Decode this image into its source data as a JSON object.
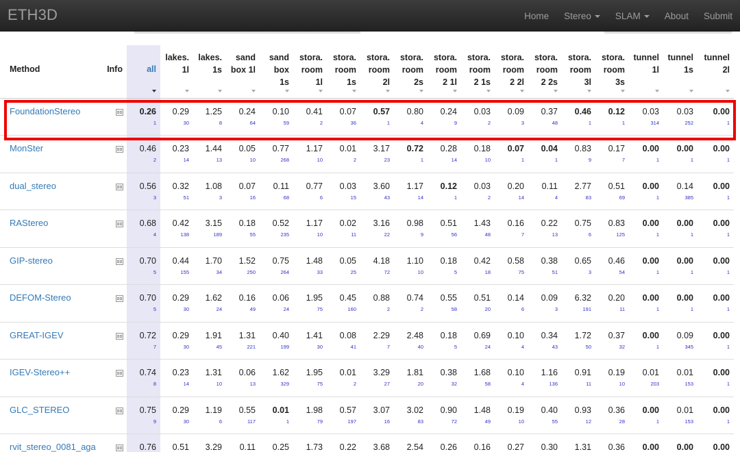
{
  "navbar": {
    "brand": "ETH3D",
    "items": [
      {
        "label": "Home",
        "dropdown": false
      },
      {
        "label": "Stereo",
        "dropdown": true
      },
      {
        "label": "SLAM",
        "dropdown": true
      },
      {
        "label": "About",
        "dropdown": false
      },
      {
        "label": "Submit",
        "dropdown": false
      }
    ]
  },
  "table": {
    "headers": {
      "method": "Method",
      "info": "Info",
      "all": "all",
      "datasets": [
        [
          "lakes.",
          "1l"
        ],
        [
          "lakes.",
          "1s"
        ],
        [
          "sand",
          "box 1l"
        ],
        [
          "sand",
          "box",
          "1s"
        ],
        [
          "stora.",
          "room",
          "1l"
        ],
        [
          "stora.",
          "room",
          "1s"
        ],
        [
          "stora.",
          "room",
          "2l"
        ],
        [
          "stora.",
          "room",
          "2s"
        ],
        [
          "stora.",
          "room",
          "2 1l"
        ],
        [
          "stora.",
          "room",
          "2 1s"
        ],
        [
          "stora.",
          "room",
          "2 2l"
        ],
        [
          "stora.",
          "room",
          "2 2s"
        ],
        [
          "stora.",
          "room",
          "3l"
        ],
        [
          "stora.",
          "room",
          "3s"
        ],
        [
          "tunnel",
          "1l"
        ],
        [
          "tunnel",
          "1s"
        ],
        [
          "tunnel",
          "2l"
        ]
      ]
    },
    "rows": [
      {
        "method": "FoundationStereo",
        "all": {
          "v": "0.26",
          "r": "1",
          "b": true
        },
        "cells": [
          {
            "v": "0.29",
            "r": "30"
          },
          {
            "v": "1.25",
            "r": "8"
          },
          {
            "v": "0.24",
            "r": "64"
          },
          {
            "v": "0.10",
            "r": "59"
          },
          {
            "v": "0.41",
            "r": "2"
          },
          {
            "v": "0.07",
            "r": "36"
          },
          {
            "v": "0.57",
            "r": "1",
            "b": true
          },
          {
            "v": "0.80",
            "r": "4"
          },
          {
            "v": "0.24",
            "r": "9"
          },
          {
            "v": "0.03",
            "r": "2"
          },
          {
            "v": "0.09",
            "r": "3"
          },
          {
            "v": "0.37",
            "r": "48"
          },
          {
            "v": "0.46",
            "r": "1",
            "b": true
          },
          {
            "v": "0.12",
            "r": "1",
            "b": true
          },
          {
            "v": "0.03",
            "r": "314"
          },
          {
            "v": "0.03",
            "r": "252"
          },
          {
            "v": "0.00",
            "r": "1",
            "b": true
          }
        ]
      },
      {
        "method": "MonSter",
        "all": {
          "v": "0.46",
          "r": "2"
        },
        "cells": [
          {
            "v": "0.23",
            "r": "14"
          },
          {
            "v": "1.44",
            "r": "13"
          },
          {
            "v": "0.05",
            "r": "10"
          },
          {
            "v": "0.77",
            "r": "268"
          },
          {
            "v": "1.17",
            "r": "10"
          },
          {
            "v": "0.01",
            "r": "2"
          },
          {
            "v": "3.17",
            "r": "23"
          },
          {
            "v": "0.72",
            "r": "1",
            "b": true
          },
          {
            "v": "0.28",
            "r": "14"
          },
          {
            "v": "0.18",
            "r": "10"
          },
          {
            "v": "0.07",
            "r": "1",
            "b": true
          },
          {
            "v": "0.04",
            "r": "1",
            "b": true
          },
          {
            "v": "0.83",
            "r": "9"
          },
          {
            "v": "0.17",
            "r": "7"
          },
          {
            "v": "0.00",
            "r": "1",
            "b": true
          },
          {
            "v": "0.00",
            "r": "1",
            "b": true
          },
          {
            "v": "0.00",
            "r": "1",
            "b": true
          }
        ]
      },
      {
        "method": "dual_stereo",
        "all": {
          "v": "0.56",
          "r": "3"
        },
        "cells": [
          {
            "v": "0.32",
            "r": "51"
          },
          {
            "v": "1.08",
            "r": "3"
          },
          {
            "v": "0.07",
            "r": "16"
          },
          {
            "v": "0.11",
            "r": "68"
          },
          {
            "v": "0.77",
            "r": "6"
          },
          {
            "v": "0.03",
            "r": "15"
          },
          {
            "v": "3.60",
            "r": "43"
          },
          {
            "v": "1.17",
            "r": "14"
          },
          {
            "v": "0.12",
            "r": "1",
            "b": true
          },
          {
            "v": "0.03",
            "r": "2"
          },
          {
            "v": "0.20",
            "r": "14"
          },
          {
            "v": "0.11",
            "r": "4"
          },
          {
            "v": "2.77",
            "r": "83"
          },
          {
            "v": "0.51",
            "r": "69"
          },
          {
            "v": "0.00",
            "r": "1",
            "b": true
          },
          {
            "v": "0.14",
            "r": "385"
          },
          {
            "v": "0.00",
            "r": "1",
            "b": true
          }
        ]
      },
      {
        "method": "RAStereo",
        "all": {
          "v": "0.68",
          "r": "4"
        },
        "cells": [
          {
            "v": "0.42",
            "r": "138"
          },
          {
            "v": "3.15",
            "r": "189"
          },
          {
            "v": "0.18",
            "r": "55"
          },
          {
            "v": "0.52",
            "r": "235"
          },
          {
            "v": "1.17",
            "r": "10"
          },
          {
            "v": "0.02",
            "r": "11"
          },
          {
            "v": "3.16",
            "r": "22"
          },
          {
            "v": "0.98",
            "r": "9"
          },
          {
            "v": "0.51",
            "r": "56"
          },
          {
            "v": "1.43",
            "r": "48"
          },
          {
            "v": "0.16",
            "r": "7"
          },
          {
            "v": "0.22",
            "r": "13"
          },
          {
            "v": "0.75",
            "r": "6"
          },
          {
            "v": "0.83",
            "r": "125"
          },
          {
            "v": "0.00",
            "r": "1",
            "b": true
          },
          {
            "v": "0.00",
            "r": "1",
            "b": true
          },
          {
            "v": "0.00",
            "r": "1",
            "b": true
          }
        ]
      },
      {
        "method": "GIP-stereo",
        "all": {
          "v": "0.70",
          "r": "5"
        },
        "cells": [
          {
            "v": "0.44",
            "r": "155"
          },
          {
            "v": "1.70",
            "r": "34"
          },
          {
            "v": "1.52",
            "r": "250"
          },
          {
            "v": "0.75",
            "r": "264"
          },
          {
            "v": "1.48",
            "r": "33"
          },
          {
            "v": "0.05",
            "r": "25"
          },
          {
            "v": "4.18",
            "r": "72"
          },
          {
            "v": "1.10",
            "r": "10"
          },
          {
            "v": "0.18",
            "r": "5"
          },
          {
            "v": "0.42",
            "r": "18"
          },
          {
            "v": "0.58",
            "r": "75"
          },
          {
            "v": "0.38",
            "r": "51"
          },
          {
            "v": "0.65",
            "r": "3"
          },
          {
            "v": "0.46",
            "r": "54"
          },
          {
            "v": "0.00",
            "r": "1",
            "b": true
          },
          {
            "v": "0.00",
            "r": "1",
            "b": true
          },
          {
            "v": "0.00",
            "r": "1",
            "b": true
          }
        ]
      },
      {
        "method": "DEFOM-Stereo",
        "all": {
          "v": "0.70",
          "r": "5"
        },
        "cells": [
          {
            "v": "0.29",
            "r": "30"
          },
          {
            "v": "1.62",
            "r": "24"
          },
          {
            "v": "0.16",
            "r": "49"
          },
          {
            "v": "0.06",
            "r": "24"
          },
          {
            "v": "1.95",
            "r": "75"
          },
          {
            "v": "0.45",
            "r": "160"
          },
          {
            "v": "0.88",
            "r": "2"
          },
          {
            "v": "0.74",
            "r": "2"
          },
          {
            "v": "0.55",
            "r": "58"
          },
          {
            "v": "0.51",
            "r": "20"
          },
          {
            "v": "0.14",
            "r": "6"
          },
          {
            "v": "0.09",
            "r": "3"
          },
          {
            "v": "6.32",
            "r": "191"
          },
          {
            "v": "0.20",
            "r": "11"
          },
          {
            "v": "0.00",
            "r": "1",
            "b": true
          },
          {
            "v": "0.00",
            "r": "1",
            "b": true
          },
          {
            "v": "0.00",
            "r": "1",
            "b": true
          }
        ]
      },
      {
        "method": "GREAT-IGEV",
        "all": {
          "v": "0.72",
          "r": "7"
        },
        "cells": [
          {
            "v": "0.29",
            "r": "30"
          },
          {
            "v": "1.91",
            "r": "45"
          },
          {
            "v": "1.31",
            "r": "221"
          },
          {
            "v": "0.40",
            "r": "199"
          },
          {
            "v": "1.41",
            "r": "30"
          },
          {
            "v": "0.08",
            "r": "41"
          },
          {
            "v": "2.29",
            "r": "7"
          },
          {
            "v": "2.48",
            "r": "40"
          },
          {
            "v": "0.18",
            "r": "5"
          },
          {
            "v": "0.69",
            "r": "24"
          },
          {
            "v": "0.10",
            "r": "4"
          },
          {
            "v": "0.34",
            "r": "43"
          },
          {
            "v": "1.72",
            "r": "50"
          },
          {
            "v": "0.37",
            "r": "32"
          },
          {
            "v": "0.00",
            "r": "1",
            "b": true
          },
          {
            "v": "0.09",
            "r": "345"
          },
          {
            "v": "0.00",
            "r": "1",
            "b": true
          }
        ]
      },
      {
        "method": "IGEV-Stereo++",
        "all": {
          "v": "0.74",
          "r": "8"
        },
        "cells": [
          {
            "v": "0.23",
            "r": "14"
          },
          {
            "v": "1.31",
            "r": "10"
          },
          {
            "v": "0.06",
            "r": "13"
          },
          {
            "v": "1.62",
            "r": "329"
          },
          {
            "v": "1.95",
            "r": "75"
          },
          {
            "v": "0.01",
            "r": "2"
          },
          {
            "v": "3.29",
            "r": "27"
          },
          {
            "v": "1.81",
            "r": "20"
          },
          {
            "v": "0.38",
            "r": "32"
          },
          {
            "v": "1.68",
            "r": "58"
          },
          {
            "v": "0.10",
            "r": "4"
          },
          {
            "v": "1.16",
            "r": "136"
          },
          {
            "v": "0.91",
            "r": "11"
          },
          {
            "v": "0.19",
            "r": "10"
          },
          {
            "v": "0.01",
            "r": "203"
          },
          {
            "v": "0.01",
            "r": "153"
          },
          {
            "v": "0.00",
            "r": "1",
            "b": true
          }
        ]
      },
      {
        "method": "GLC_STEREO",
        "all": {
          "v": "0.75",
          "r": "9"
        },
        "cells": [
          {
            "v": "0.29",
            "r": "30"
          },
          {
            "v": "1.19",
            "r": "6"
          },
          {
            "v": "0.55",
            "r": "117"
          },
          {
            "v": "0.01",
            "r": "1",
            "b": true
          },
          {
            "v": "1.98",
            "r": "79"
          },
          {
            "v": "0.57",
            "r": "197"
          },
          {
            "v": "3.07",
            "r": "16"
          },
          {
            "v": "3.02",
            "r": "83"
          },
          {
            "v": "0.90",
            "r": "72"
          },
          {
            "v": "1.48",
            "r": "49"
          },
          {
            "v": "0.19",
            "r": "10"
          },
          {
            "v": "0.40",
            "r": "55"
          },
          {
            "v": "0.93",
            "r": "12"
          },
          {
            "v": "0.36",
            "r": "28"
          },
          {
            "v": "0.00",
            "r": "1",
            "b": true
          },
          {
            "v": "0.01",
            "r": "153"
          },
          {
            "v": "0.00",
            "r": "1",
            "b": true
          }
        ]
      },
      {
        "method": "rvit_stereo_0081_aga",
        "all": {
          "v": "0.76",
          "r": ""
        },
        "cells": [
          {
            "v": "0.51",
            "r": ""
          },
          {
            "v": "3.29",
            "r": ""
          },
          {
            "v": "0.11",
            "r": ""
          },
          {
            "v": "0.25",
            "r": ""
          },
          {
            "v": "1.73",
            "r": ""
          },
          {
            "v": "0.22",
            "r": ""
          },
          {
            "v": "3.68",
            "r": ""
          },
          {
            "v": "2.54",
            "r": ""
          },
          {
            "v": "0.26",
            "r": ""
          },
          {
            "v": "0.16",
            "r": ""
          },
          {
            "v": "0.27",
            "r": ""
          },
          {
            "v": "0.30",
            "r": ""
          },
          {
            "v": "1.31",
            "r": ""
          },
          {
            "v": "0.36",
            "r": ""
          },
          {
            "v": "0.00",
            "r": "",
            "b": true
          },
          {
            "v": "0.00",
            "r": "",
            "b": true
          },
          {
            "v": "0.00",
            "r": "",
            "b": true
          }
        ]
      }
    ]
  },
  "highlight": {
    "color": "#ee0000",
    "row": "FoundationStereo"
  }
}
